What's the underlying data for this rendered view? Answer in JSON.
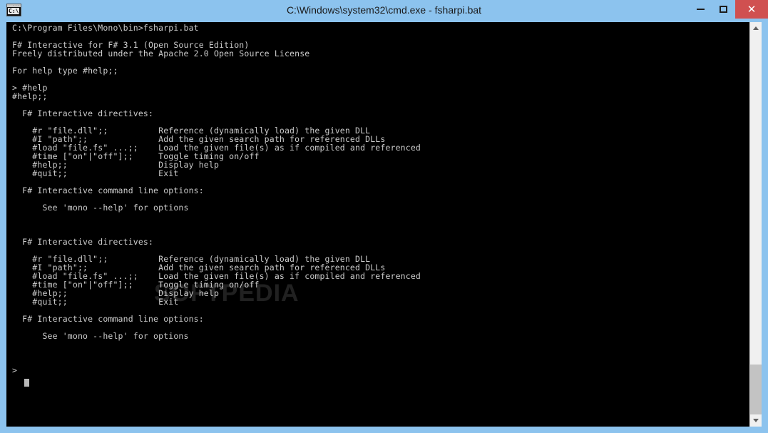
{
  "window": {
    "title": "C:\\Windows\\system32\\cmd.exe - fsharpi.bat",
    "icon": "cmd-console-icon",
    "icon_text": "C:\\",
    "frame_color": "#8cc3ee",
    "controls": {
      "minimize": {
        "label": "–",
        "name": "minimize-button"
      },
      "maximize": {
        "label": "□",
        "name": "maximize-button"
      },
      "close": {
        "label": "✕",
        "name": "close-button",
        "color": "#d05050"
      }
    }
  },
  "console": {
    "background_color": "#000000",
    "text_color": "#cccccc",
    "prompt_symbol": ">",
    "lines": [
      "C:\\Program Files\\Mono\\bin>fsharpi.bat",
      "",
      "F# Interactive for F# 3.1 (Open Source Edition)",
      "Freely distributed under the Apache 2.0 Open Source License",
      "",
      "For help type #help;;",
      "",
      "> #help",
      "#help;;",
      "",
      "  F# Interactive directives:",
      "",
      "    #r \"file.dll\";;          Reference (dynamically load) the given DLL",
      "    #I \"path\";;              Add the given search path for referenced DLLs",
      "    #load \"file.fs\" ...;;    Load the given file(s) as if compiled and referenced",
      "    #time [\"on\"|\"off\"];;     Toggle timing on/off",
      "    #help;;                  Display help",
      "    #quit;;                  Exit",
      "",
      "  F# Interactive command line options:",
      "",
      "      See 'mono --help' for options",
      "",
      "",
      "",
      "  F# Interactive directives:",
      "",
      "    #r \"file.dll\";;          Reference (dynamically load) the given DLL",
      "    #I \"path\";;              Add the given search path for referenced DLLs",
      "    #load \"file.fs\" ...;;    Load the given file(s) as if compiled and referenced",
      "    #time [\"on\"|\"off\"];;     Toggle timing on/off",
      "    #help;;                  Display help",
      "    #quit;;                  Exit",
      "",
      "  F# Interactive command line options:",
      "",
      "      See 'mono --help' for options",
      "",
      "",
      "",
      ">"
    ]
  },
  "watermark": {
    "text": "SOFTPEDIA"
  },
  "scrollbar": {
    "up_arrow": "scroll-up-arrow",
    "down_arrow": "scroll-down-arrow",
    "thumb_position_percent": 87
  }
}
